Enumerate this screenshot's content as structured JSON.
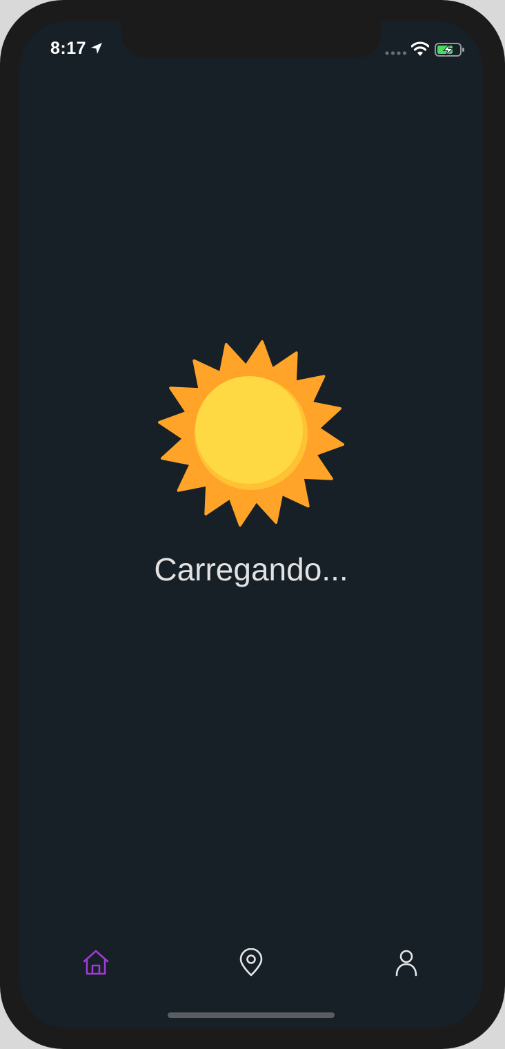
{
  "status_bar": {
    "time": "8:17",
    "icons": [
      "location-arrow-icon",
      "signal-icon",
      "wifi-icon",
      "battery-charging-icon"
    ]
  },
  "main": {
    "loading_text": "Carregando...",
    "icon": "sun-icon"
  },
  "tab_bar": {
    "tabs": [
      {
        "icon": "home-icon",
        "active": true
      },
      {
        "icon": "map-pin-icon",
        "active": false
      },
      {
        "icon": "user-icon",
        "active": false
      }
    ]
  },
  "colors": {
    "background": "#171f27",
    "accent": "#a13ad8",
    "icon_inactive": "#e6e6e6",
    "sun_rays": "#ffa428",
    "sun_core": "#ffd944",
    "battery_fill": "#4cd964"
  }
}
